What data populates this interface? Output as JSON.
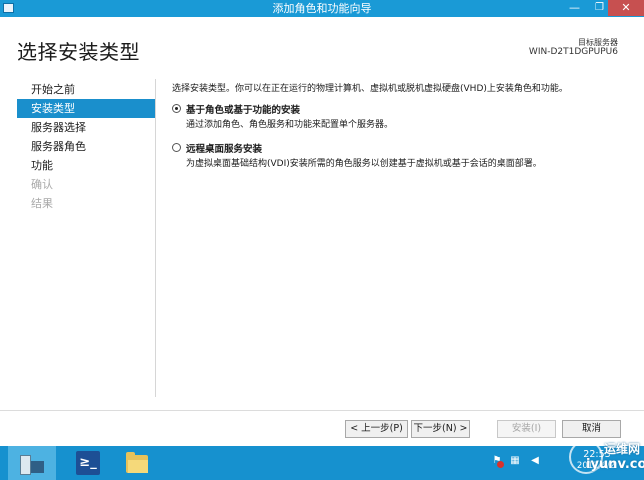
{
  "window": {
    "title": "添加角色和功能向导",
    "minimize_glyph": "—",
    "maximize_glyph": "❐",
    "close_glyph": "✕"
  },
  "header": {
    "page_title": "选择安装类型",
    "target_server_label": "目标服务器",
    "target_server_name": "WIN-D2T1DGPUPU6"
  },
  "sidebar": {
    "items": [
      {
        "label": "开始之前",
        "state": "normal"
      },
      {
        "label": "安装类型",
        "state": "active"
      },
      {
        "label": "服务器选择",
        "state": "normal"
      },
      {
        "label": "服务器角色",
        "state": "normal"
      },
      {
        "label": "功能",
        "state": "normal"
      },
      {
        "label": "确认",
        "state": "disabled"
      },
      {
        "label": "结果",
        "state": "disabled"
      }
    ]
  },
  "main": {
    "intro": "选择安装类型。你可以在正在运行的物理计算机、虚拟机或脱机虚拟硬盘(VHD)上安装角色和功能。",
    "options": [
      {
        "label": "基于角色或基于功能的安装",
        "description": "通过添加角色、角色服务和功能来配置单个服务器。",
        "checked": true
      },
      {
        "label": "远程桌面服务安装",
        "description": "为虚拟桌面基础结构(VDI)安装所需的角色服务以创建基于虚拟机或基于会话的桌面部署。",
        "checked": false
      }
    ]
  },
  "footer": {
    "prev_label": "< 上一步(P)",
    "next_label": "下一步(N) >",
    "install_label": "安装(I)",
    "cancel_label": "取消"
  },
  "taskbar": {
    "items": [
      {
        "icon": "server-manager-icon",
        "active": true
      },
      {
        "icon": "powershell-icon",
        "glyph": "≥_",
        "active": false
      },
      {
        "icon": "file-explorer-icon",
        "active": false
      }
    ],
    "tray": {
      "clock_time": "22:53",
      "clock_date": "2012/6/2"
    }
  },
  "watermark": {
    "top": "运维网",
    "bottom": "iyunv.com"
  },
  "colors": {
    "accent": "#1a9ad6",
    "nav_active": "#1a8fcc",
    "close_button": "#c75050",
    "taskbar": "#1691cf"
  }
}
